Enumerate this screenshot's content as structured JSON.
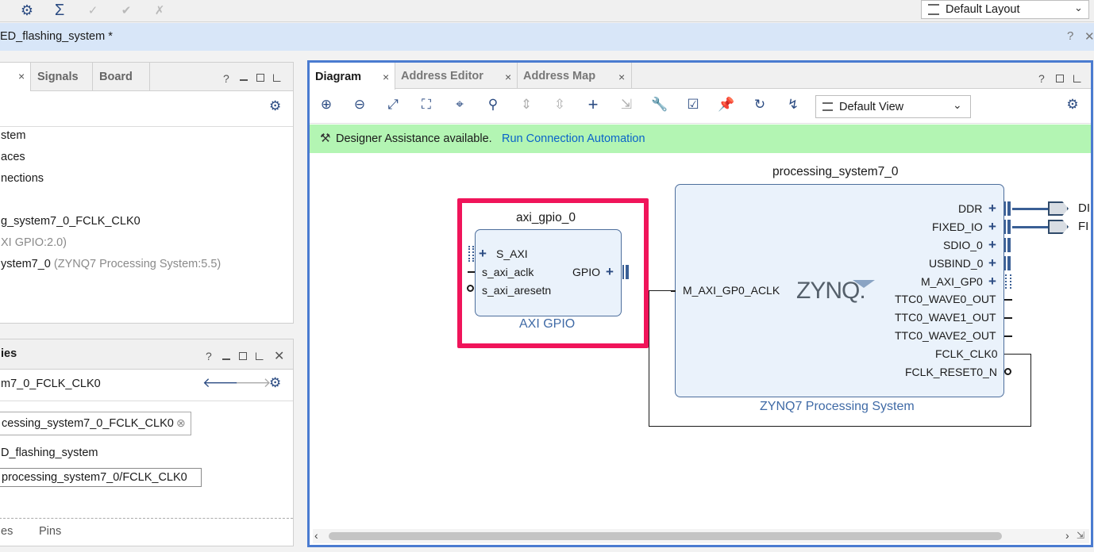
{
  "toolbar": {
    "icons": [
      "gear-icon",
      "sigma-icon",
      "checkmark-icon",
      "checkmark-double-icon",
      "cross-icon"
    ],
    "layout_select": "Default Layout"
  },
  "title_bar": {
    "title": "ED_flashing_system *",
    "help": "?",
    "close": "✕"
  },
  "sources_panel": {
    "tabs": [
      "Signals",
      "Board"
    ],
    "tab_close": "×",
    "tree": {
      "item1": "stem",
      "item2": "aces",
      "item3": "nections",
      "item4": "g_system7_0_FCLK_CLK0",
      "item5_gray": "XI GPIO:2.0)",
      "item6_main": "ystem7_0 ",
      "item6_gray": "(ZYNQ7 Processing System:5.5)"
    }
  },
  "properties_panel": {
    "title": "ies",
    "object": "m7_0_FCLK_CLK0",
    "name_value": "cessing_system7_0_FCLK_CLK0",
    "design": "D_flashing_system",
    "path_value": "processing_system7_0/FCLK_CLK0",
    "bottom_tabs": [
      "es",
      "Pins"
    ]
  },
  "diagram": {
    "tabs": [
      "Diagram",
      "Address Editor",
      "Address Map"
    ],
    "view_select": "Default View",
    "assist_text": "Designer Assistance available.",
    "assist_link": "Run Connection Automation",
    "gpio": {
      "instance": "axi_gpio_0",
      "subtitle": "AXI GPIO",
      "ports_left": [
        "S_AXI",
        "s_axi_aclk",
        "s_axi_aresetn"
      ],
      "port_right": "GPIO"
    },
    "ps7": {
      "instance": "processing_system7_0",
      "subtitle": "ZYNQ7 Processing System",
      "logo": "ZYNQ.",
      "port_left": "M_AXI_GP0_ACLK",
      "ports_right": [
        "DDR",
        "FIXED_IO",
        "SDIO_0",
        "USBIND_0",
        "M_AXI_GP0",
        "TTC0_WAVE0_OUT",
        "TTC0_WAVE1_OUT",
        "TTC0_WAVE2_OUT",
        "FCLK_CLK0",
        "FCLK_RESET0_N"
      ]
    },
    "ext_ports": [
      "DI",
      "FI"
    ],
    "highlight_color": "#f0145a"
  }
}
